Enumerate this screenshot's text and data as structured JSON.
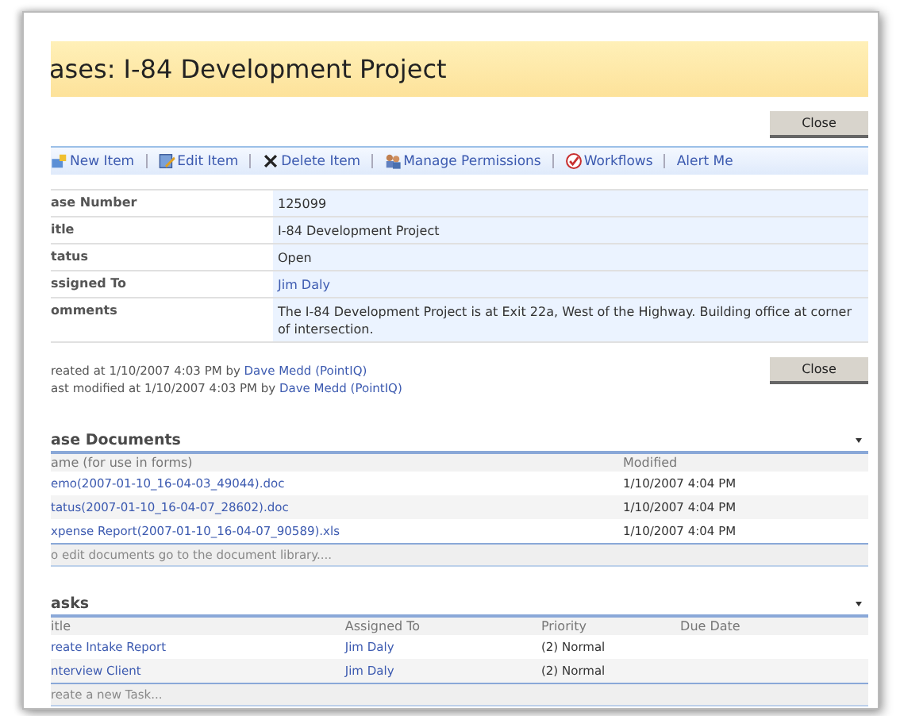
{
  "page_title": "ases: I-84 Development Project",
  "close_buttons": [
    "Close",
    "Close"
  ],
  "toolbar": [
    {
      "label": "New Item",
      "kind": "new"
    },
    {
      "label": "Edit Item",
      "kind": "edit"
    },
    {
      "label": "Delete Item",
      "kind": "delete"
    },
    {
      "label": "Manage Permissions",
      "kind": "permissions"
    },
    {
      "label": "Workflows",
      "kind": "workflows"
    },
    {
      "label": "Alert Me",
      "kind": "none"
    }
  ],
  "fields": [
    {
      "label": "ase Number",
      "value": "125099",
      "kind": "text"
    },
    {
      "label": "itle",
      "value": "I-84 Development Project",
      "kind": "text"
    },
    {
      "label": "tatus",
      "value": "Open",
      "kind": "text"
    },
    {
      "label": "ssigned To",
      "value": "Jim Daly",
      "kind": "link"
    },
    {
      "label": "omments",
      "value": "The I-84 Development Project is at Exit 22a, West of the Highway.  Building office at corner of intersection.",
      "kind": "text"
    }
  ],
  "audit": [
    {
      "text": "reated at 1/10/2007 4:03 PM  by",
      "user": "Dave Medd (PointIQ)"
    },
    {
      "text": "ast modified at 1/10/2007 4:03 PM  by",
      "user": "Dave Medd (PointIQ)"
    }
  ],
  "documents": {
    "title": "ase Documents",
    "columns": [
      "ame (for use in forms)",
      "Modified"
    ],
    "rows": [
      [
        "emo(2007-01-10_16-04-03_49044).doc",
        "1/10/2007 4:04 PM"
      ],
      [
        "tatus(2007-01-10_16-04-07_28602).doc",
        "1/10/2007 4:04 PM"
      ],
      [
        "xpense Report(2007-01-10_16-04-07_90589).xls",
        "1/10/2007 4:04 PM"
      ]
    ],
    "footer": "o edit documents go to the document library...."
  },
  "tasks": {
    "title": "asks",
    "columns": [
      "itle",
      "Assigned To",
      "Priority",
      "Due Date"
    ],
    "rows": [
      [
        "reate Intake Report",
        "Jim Daly",
        "(2) Normal",
        ""
      ],
      [
        "nterview Client",
        "Jim Daly",
        "(2) Normal",
        ""
      ]
    ],
    "footer": "reate a new Task..."
  }
}
